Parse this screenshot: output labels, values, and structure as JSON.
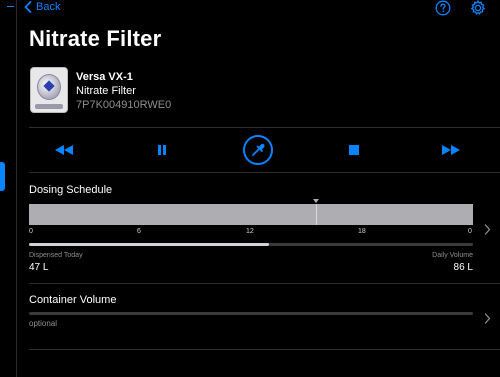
{
  "nav": {
    "back_label": "Back"
  },
  "page": {
    "title": "Nitrate Filter"
  },
  "device": {
    "model": "Versa VX-1",
    "name": "Nitrate Filter",
    "serial": "7P7K004910RWE0"
  },
  "controls": {
    "items": [
      {
        "icon": "rewind-icon"
      },
      {
        "icon": "pause-icon"
      },
      {
        "icon": "pipette-icon"
      },
      {
        "icon": "stop-icon"
      },
      {
        "icon": "fast-forward-icon"
      }
    ]
  },
  "schedule": {
    "label": "Dosing Schedule",
    "ticks": [
      "0",
      "6",
      "12",
      "18",
      "0"
    ],
    "dispensed_label": "Dispensed Today",
    "dispensed_value": "47 L",
    "daily_label": "Daily Volume",
    "daily_value": "86 L",
    "dispensed_fraction": 0.54
  },
  "container": {
    "label": "Container Volume",
    "placeholder": "optional"
  },
  "colors": {
    "accent": "#0a84ff",
    "background": "#000000",
    "separator": "#2c2c2e",
    "secondary_text": "#8e8e93"
  }
}
